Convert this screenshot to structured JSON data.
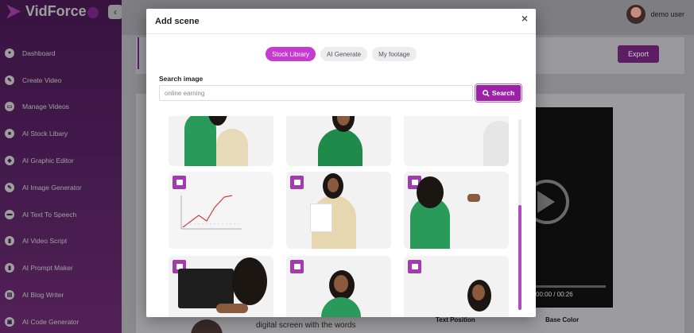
{
  "app": {
    "name": "VidForce"
  },
  "sidebar": {
    "items": [
      {
        "label": "Dashboard",
        "icon": "dashboard-icon"
      },
      {
        "label": "Create Video",
        "icon": "pencil-icon"
      },
      {
        "label": "Manage Videos",
        "icon": "folder-icon"
      },
      {
        "label": "AI Stock Libary",
        "icon": "library-icon"
      },
      {
        "label": "AI Graphic Editor",
        "icon": "graphic-icon"
      },
      {
        "label": "AI Image Generator",
        "icon": "image-icon"
      },
      {
        "label": "AI Text To Speech",
        "icon": "speech-icon"
      },
      {
        "label": "AI Video Script",
        "icon": "script-icon"
      },
      {
        "label": "AI Prompt Maker",
        "icon": "prompt-icon"
      },
      {
        "label": "AI Blog Writer",
        "icon": "blog-icon"
      },
      {
        "label": "AI Code Generator",
        "icon": "code-icon"
      }
    ]
  },
  "header": {
    "user_name": "demo user"
  },
  "editor": {
    "export_label": "Export",
    "video_time": "00:00 / 00:26",
    "caption_text": "digital screen with the words",
    "text_position_label": "Text Position",
    "base_color_label": "Base Color"
  },
  "modal": {
    "title": "Add scene",
    "close_glyph": "×",
    "tabs": [
      {
        "label": "Stock Library",
        "active": true
      },
      {
        "label": "AI Generate",
        "active": false
      },
      {
        "label": "My footage",
        "active": false
      }
    ],
    "search_label": "Search image",
    "search_value": "online earning",
    "search_button": "Search",
    "search_icon": "search-icon",
    "accent_color": "#9e1fa8",
    "thumbnails": [
      {
        "name": "thumb-woman-laughing",
        "add_visible": false
      },
      {
        "name": "thumb-woman-hand-face",
        "add_visible": false
      },
      {
        "name": "thumb-woman-partial",
        "add_visible": false
      },
      {
        "name": "thumb-chart-board",
        "add_visible": true
      },
      {
        "name": "thumb-woman-holding-paper",
        "add_visible": true
      },
      {
        "name": "thumb-woman-writing-board",
        "add_visible": true
      },
      {
        "name": "thumb-laptop-trading",
        "add_visible": true
      },
      {
        "name": "thumb-woman-glasses",
        "add_visible": true
      },
      {
        "name": "thumb-woman-portrait",
        "add_visible": true
      }
    ]
  }
}
